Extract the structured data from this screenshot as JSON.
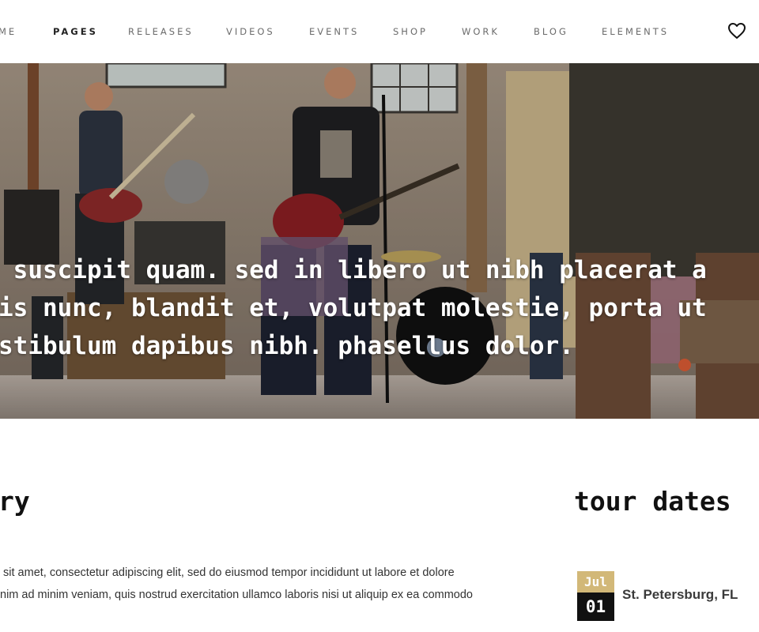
{
  "nav": {
    "items": [
      {
        "label": "ME"
      },
      {
        "label": "PAGES"
      },
      {
        "label": "RELEASES"
      },
      {
        "label": "VIDEOS"
      },
      {
        "label": "EVENTS"
      },
      {
        "label": "SHOP"
      },
      {
        "label": "WORK"
      },
      {
        "label": "BLOG"
      },
      {
        "label": "ELEMENTS"
      }
    ],
    "active": "PAGES",
    "wishlist_icon": "heart-icon"
  },
  "hero": {
    "lines": [
      "odo suscipit quam. sed in libero ut nibh placerat a",
      "urpis nunc, blandit et, volutpat molestie, porta ut",
      " vestibulum dapibus nibh. phasellus dolor."
    ]
  },
  "story": {
    "title": "ry",
    "paragraph_lines": [
      " sit amet, consectetur adipiscing elit, sed do eiusmod tempor incididunt ut labore et dolore",
      "nim ad minim veniam, quis nostrud exercitation ullamco laboris nisi ut aliquip ex ea commodo"
    ]
  },
  "tour": {
    "title": "tour dates",
    "dates": [
      {
        "month": "Jul",
        "day": "01",
        "city": "St. Petersburg, FL"
      }
    ]
  },
  "colors": {
    "accent": "#d2b878",
    "dark": "#111111"
  }
}
